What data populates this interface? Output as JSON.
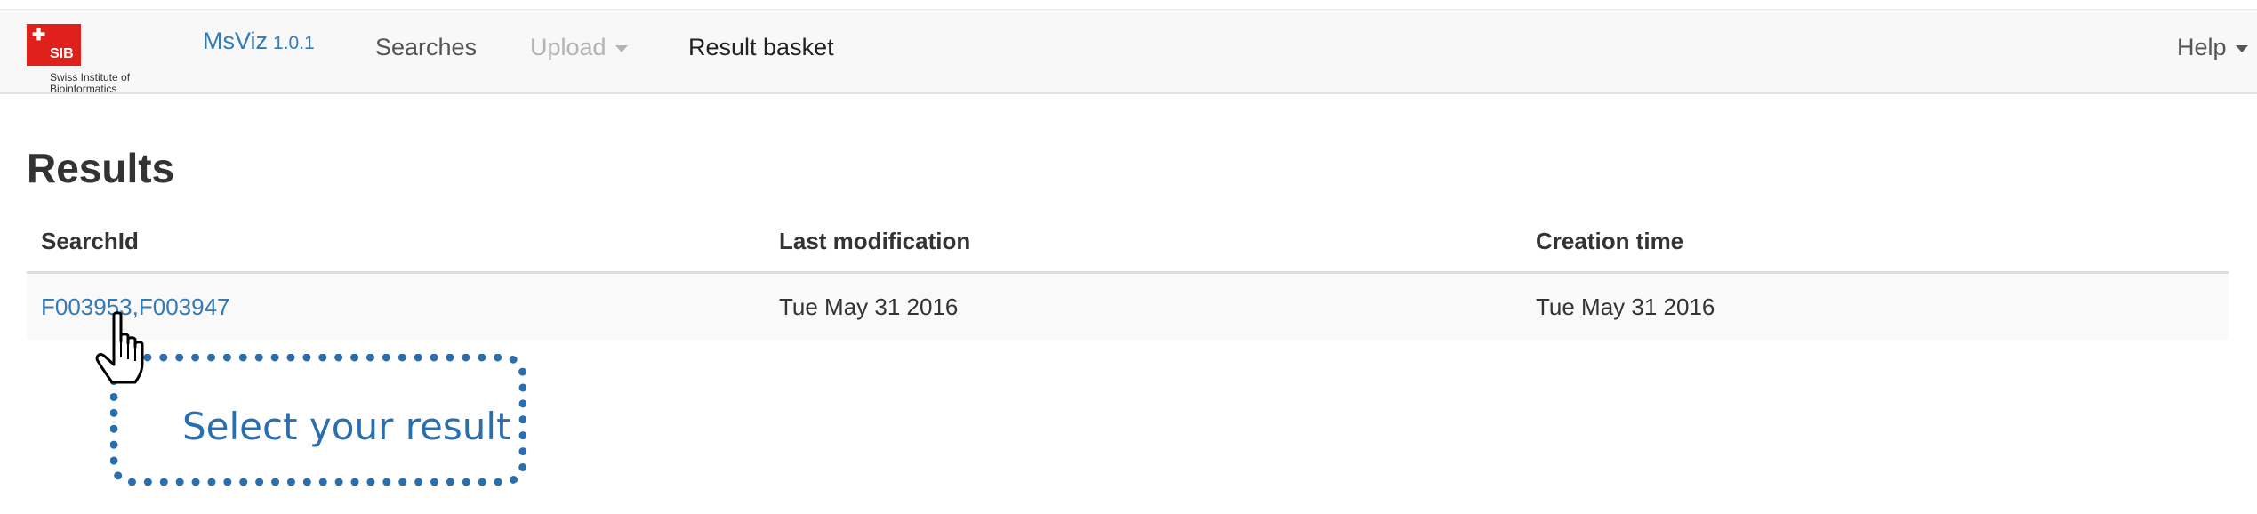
{
  "navbar": {
    "logo": {
      "abbr": "SIB",
      "text": "Swiss Institute of Bioinformatics"
    },
    "brand": {
      "name": "MsViz",
      "version": "1.0.1"
    },
    "links": [
      {
        "label": "Searches",
        "state": "normal"
      },
      {
        "label": "Upload",
        "state": "disabled",
        "has_dropdown": true
      },
      {
        "label": "Result basket",
        "state": "active"
      }
    ],
    "help": {
      "label": "Help",
      "has_dropdown": true
    }
  },
  "page": {
    "title": "Results"
  },
  "table": {
    "columns": [
      "SearchId",
      "Last modification",
      "Creation time"
    ],
    "rows": [
      {
        "search_id": "F003953,F003947",
        "last_modification": "Tue May 31 2016",
        "creation_time": "Tue May 31 2016"
      }
    ]
  },
  "annotation": {
    "callout_text": "Select your result",
    "cursor_icon": "hand-pointer-icon",
    "color": "#2a6fad"
  },
  "colors": {
    "link": "#337ab7",
    "navbar_bg": "#f8f8f8",
    "logo_red": "#e0201b"
  }
}
